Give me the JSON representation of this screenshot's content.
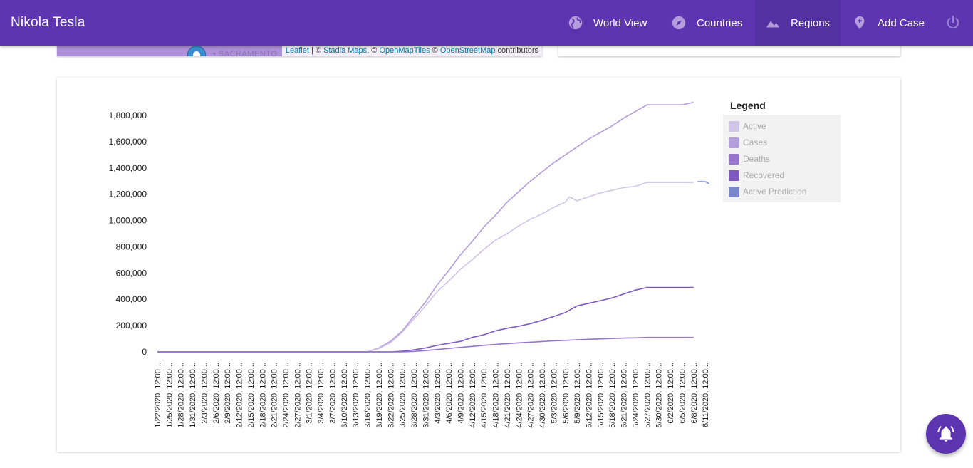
{
  "app": {
    "title": "Nikola Tesla"
  },
  "nav": [
    {
      "label": "World View",
      "icon": "globe-icon"
    },
    {
      "label": "Countries",
      "icon": "compass-icon"
    },
    {
      "label": "Regions",
      "icon": "mountain-icon",
      "active": true
    },
    {
      "label": "Add Case",
      "icon": "add-location-icon"
    }
  ],
  "map": {
    "city_label": "• SACRAMENTO",
    "attribution": {
      "leaflet": "Leaflet",
      "sep1": " | © ",
      "stadia": "Stadia Maps",
      "sep2": ", © ",
      "omt": "OpenMapTiles",
      "sep3": " © ",
      "osm": "OpenStreetMap",
      "suffix": " contributors"
    }
  },
  "legend": {
    "title": "Legend",
    "items": [
      {
        "label": "Active",
        "color": "#d1c4e9"
      },
      {
        "label": "Cases",
        "color": "#b39ddb"
      },
      {
        "label": "Deaths",
        "color": "#9575cd"
      },
      {
        "label": "Recovered",
        "color": "#7e57c2"
      },
      {
        "label": "Active Prediction",
        "color": "#7986cb"
      }
    ]
  },
  "chart_data": {
    "type": "line",
    "ylim": [
      0,
      1800000
    ],
    "yticks": [
      0,
      200000,
      400000,
      600000,
      800000,
      1000000,
      1200000,
      1400000,
      1600000,
      1800000
    ],
    "ytick_labels": [
      "0",
      "200,000",
      "400,000",
      "600,000",
      "800,000",
      "1,000,000",
      "1,200,000",
      "1,400,000",
      "1,600,000",
      "1,800,000"
    ],
    "x_tick_labels": [
      "1/22/2020, 12:00...",
      "1/25/2020, 12:00...",
      "1/28/2020, 12:00...",
      "1/31/2020, 12:00...",
      "2/3/2020, 12:00...",
      "2/6/2020, 12:00...",
      "2/9/2020, 12:00...",
      "2/12/2020, 12:00...",
      "2/15/2020, 12:00...",
      "2/18/2020, 12:00...",
      "2/21/2020, 12:00...",
      "2/24/2020, 12:00...",
      "2/27/2020, 12:00...",
      "3/1/2020, 12:00...",
      "3/4/2020, 12:00...",
      "3/7/2020, 12:00...",
      "3/10/2020, 12:00...",
      "3/13/2020, 12:00...",
      "3/16/2020, 12:00...",
      "3/19/2020, 12:00...",
      "3/22/2020, 12:00...",
      "3/25/2020, 12:00...",
      "3/28/2020, 12:00...",
      "3/31/2020, 12:00...",
      "4/3/2020, 12:00...",
      "4/6/2020, 12:00...",
      "4/9/2020, 12:00...",
      "4/12/2020, 12:00...",
      "4/15/2020, 12:00...",
      "4/18/2020, 12:00...",
      "4/21/2020, 12:00...",
      "4/24/2020, 12:00...",
      "4/27/2020, 12:00...",
      "4/30/2020, 12:00...",
      "5/3/2020, 12:00...",
      "5/6/2020, 12:00...",
      "5/9/2020, 12:00...",
      "5/12/2020, 12:00...",
      "5/15/2020, 12:00...",
      "5/18/2020, 12:00...",
      "5/21/2020, 12:00...",
      "5/24/2020, 12:00...",
      "5/27/2020, 12:00...",
      "5/30/2020, 12:00...",
      "6/2/2020, 12:00...",
      "6/5/2020, 12:00...",
      "6/8/2020, 12:00...",
      "6/11/2020, 12:00..."
    ],
    "series": [
      {
        "name": "Cases",
        "color": "#b39ddb",
        "x": [
          0,
          54,
          57,
          60,
          63,
          66,
          69,
          72,
          75,
          78,
          81,
          84,
          87,
          90,
          93,
          96,
          99,
          102,
          105,
          108,
          111,
          114,
          117,
          120,
          123,
          126,
          129,
          132,
          135,
          138
        ],
        "y": [
          0,
          0,
          30000,
          80000,
          160000,
          270000,
          380000,
          510000,
          620000,
          740000,
          840000,
          950000,
          1040000,
          1140000,
          1220000,
          1300000,
          1370000,
          1440000,
          1500000,
          1560000,
          1620000,
          1670000,
          1720000,
          1780000,
          1830000,
          1880000,
          1880000,
          1880000,
          1880000,
          1900000
        ]
      },
      {
        "name": "Active",
        "color": "#d1c4e9",
        "x": [
          0,
          54,
          57,
          60,
          63,
          66,
          69,
          72,
          75,
          78,
          81,
          84,
          87,
          90,
          93,
          96,
          99,
          102,
          105,
          106,
          108,
          111,
          114,
          117,
          120,
          123,
          126,
          135,
          138
        ],
        "y": [
          0,
          0,
          25000,
          70000,
          150000,
          250000,
          350000,
          460000,
          540000,
          630000,
          700000,
          780000,
          850000,
          900000,
          960000,
          1010000,
          1050000,
          1100000,
          1140000,
          1180000,
          1150000,
          1180000,
          1210000,
          1230000,
          1250000,
          1260000,
          1290000,
          1290000,
          1290000
        ]
      },
      {
        "name": "Recovered",
        "color": "#7e57c2",
        "x": [
          0,
          60,
          63,
          66,
          69,
          72,
          75,
          78,
          81,
          84,
          87,
          90,
          93,
          96,
          99,
          102,
          105,
          108,
          111,
          114,
          117,
          120,
          123,
          126,
          135,
          138
        ],
        "y": [
          0,
          0,
          5000,
          15000,
          30000,
          50000,
          65000,
          80000,
          110000,
          130000,
          160000,
          180000,
          195000,
          215000,
          240000,
          270000,
          300000,
          350000,
          370000,
          390000,
          410000,
          440000,
          470000,
          490000,
          490000,
          490000
        ]
      },
      {
        "name": "Deaths",
        "color": "#9575cd",
        "x": [
          0,
          63,
          66,
          69,
          72,
          75,
          78,
          81,
          84,
          87,
          90,
          93,
          96,
          99,
          102,
          105,
          108,
          111,
          114,
          117,
          120,
          123,
          126,
          138
        ],
        "y": [
          0,
          0,
          4000,
          10000,
          18000,
          26000,
          34000,
          42000,
          50000,
          57000,
          63000,
          69000,
          74000,
          79000,
          84000,
          88000,
          92000,
          96000,
          99000,
          102000,
          105000,
          107000,
          110000,
          110000
        ]
      },
      {
        "name": "Active Prediction",
        "color": "#7986cb",
        "x": [
          139,
          140,
          141,
          142
        ],
        "y": [
          1295000,
          1295000,
          1295000,
          1280000
        ]
      }
    ]
  }
}
